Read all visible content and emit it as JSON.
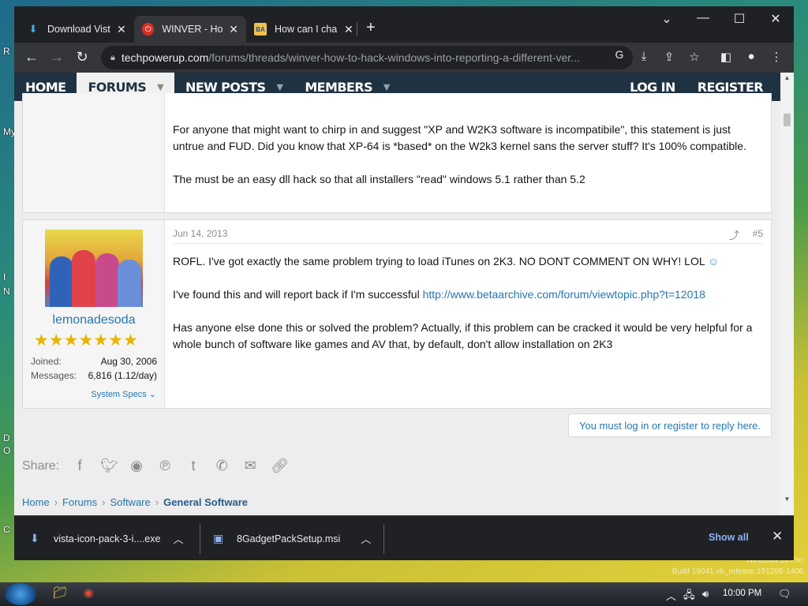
{
  "desktop": {
    "left_fragments": [
      "R",
      "My",
      "I",
      "N",
      "O",
      "D",
      "C"
    ],
    "watermark_lines": [
      "Windows 10 Pro",
      "Build 19041.vb_release.191206-1406"
    ]
  },
  "browser": {
    "tabs": [
      {
        "title": "Download Vist",
        "icon": "download-icon",
        "active": false
      },
      {
        "title": "WINVER - How",
        "icon": "power-icon",
        "active": true
      },
      {
        "title": "How can I cha",
        "icon": "ba-icon",
        "active": false
      }
    ],
    "url_host": "techpowerup.com",
    "url_path": "/forums/threads/winver-how-to-hack-windows-into-reporting-a-different-ver..."
  },
  "site_nav": {
    "items": [
      {
        "label": "HOME",
        "selected": false,
        "caret": false
      },
      {
        "label": "FORUMS",
        "selected": true,
        "caret": true
      },
      {
        "label": "NEW POSTS",
        "selected": false,
        "caret": true
      },
      {
        "label": "MEMBERS",
        "selected": false,
        "caret": true
      }
    ],
    "login": "LOG IN",
    "register": "REGISTER"
  },
  "post_prev": {
    "paragraphs": [
      "For anyone that might want to chirp in and suggest \"XP and W2K3 software is incompatibile\", this statement is just untrue and FUD. Did you know that XP-64 is *based* on the W2k3 kernel sans the server stuff? It's 100% compatible.",
      "The must be an easy dll hack so that all installers \"read\" windows 5.1 rather than 5.2"
    ]
  },
  "post": {
    "date": "Jun 14, 2013",
    "number": "#5",
    "username": "lemonadesoda",
    "stars": "★★★★★★★",
    "joined_label": "Joined:",
    "joined_value": "Aug 30, 2006",
    "messages_label": "Messages:",
    "messages_value": "6,816 (1.12/day)",
    "system_specs": "System Specs ⌄",
    "para1": "ROFL. I've got exactly the same problem trying to load iTunes on 2K3. NO DONT COMMENT ON WHY! LOL",
    "para2_text": "I've found this and will report back if I'm successful ",
    "para2_link": "http://www.betaarchive.com/forum/viewtopic.php?t=12018",
    "para3": "Has anyone else done this or solved the problem? Actually, if this problem can be cracked it would be very helpful for a whole bunch of software like games and AV that, by default, don't allow installation on 2K3"
  },
  "reply_notice": "You must log in or register to reply here.",
  "share_label": "Share:",
  "breadcrumbs": [
    "Home",
    "Forums",
    "Software",
    "General Software"
  ],
  "downloads": {
    "items": [
      "vista-icon-pack-3-i....exe",
      "8GadgetPackSetup.msi"
    ],
    "show_all": "Show all"
  },
  "taskbar": {
    "time": "10:00 PM"
  },
  "colors": {
    "nav_bg": "#1f3242",
    "link": "#2577b1",
    "chrome_dark": "#202124",
    "chrome_toolbar": "#35363a"
  }
}
